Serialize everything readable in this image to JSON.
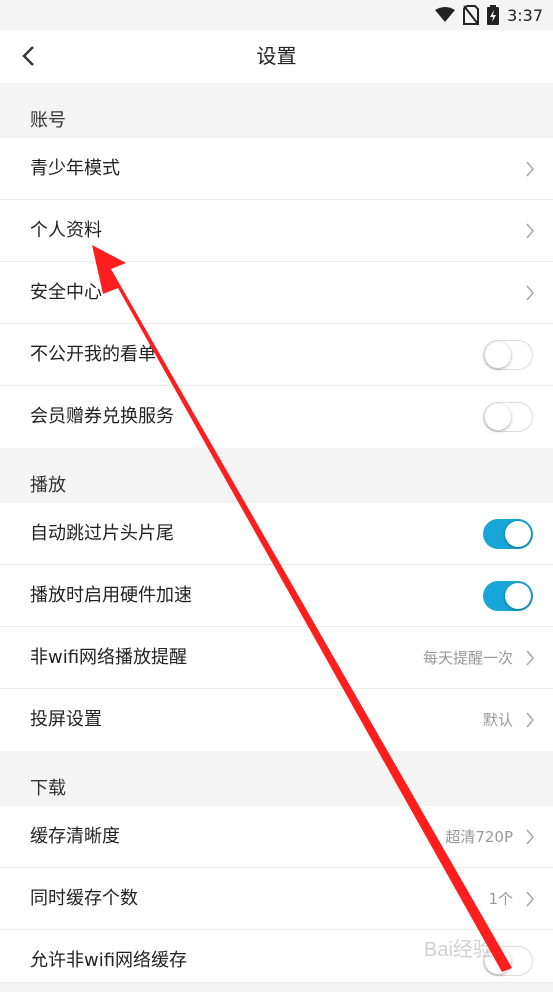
{
  "status_bar": {
    "time": "3:37",
    "icons": [
      "wifi-icon",
      "no-sim-icon",
      "battery-charging-icon"
    ]
  },
  "nav": {
    "title": "设置",
    "back_icon": "chevron-left-icon"
  },
  "sections": [
    {
      "header": "账号",
      "rows": [
        {
          "label": "青少年模式",
          "control": "chevron"
        },
        {
          "label": "个人资料",
          "control": "chevron"
        },
        {
          "label": "安全中心",
          "control": "chevron"
        },
        {
          "label": "不公开我的看单",
          "control": "toggle",
          "on": false
        },
        {
          "label": "会员赠券兑换服务",
          "control": "toggle",
          "on": false
        }
      ]
    },
    {
      "header": "播放",
      "rows": [
        {
          "label": "自动跳过片头片尾",
          "control": "toggle",
          "on": true
        },
        {
          "label": "播放时启用硬件加速",
          "control": "toggle",
          "on": true
        },
        {
          "label": "非wifi网络播放提醒",
          "control": "chevron",
          "value": "每天提醒一次"
        },
        {
          "label": "投屏设置",
          "control": "chevron",
          "value": "默认"
        }
      ]
    },
    {
      "header": "下载",
      "rows": [
        {
          "label": "缓存清晰度",
          "control": "chevron",
          "value": "超清720P"
        },
        {
          "label": "同时缓存个数",
          "control": "chevron",
          "value": "1个"
        },
        {
          "label": "允许非wifi网络缓存",
          "control": "toggle",
          "on": false
        }
      ]
    }
  ],
  "colors": {
    "toggle_on": "#18a6d8",
    "annotation_arrow": "#ff1e1e",
    "background": "#f4f4f4"
  },
  "watermark": "Bai经验"
}
